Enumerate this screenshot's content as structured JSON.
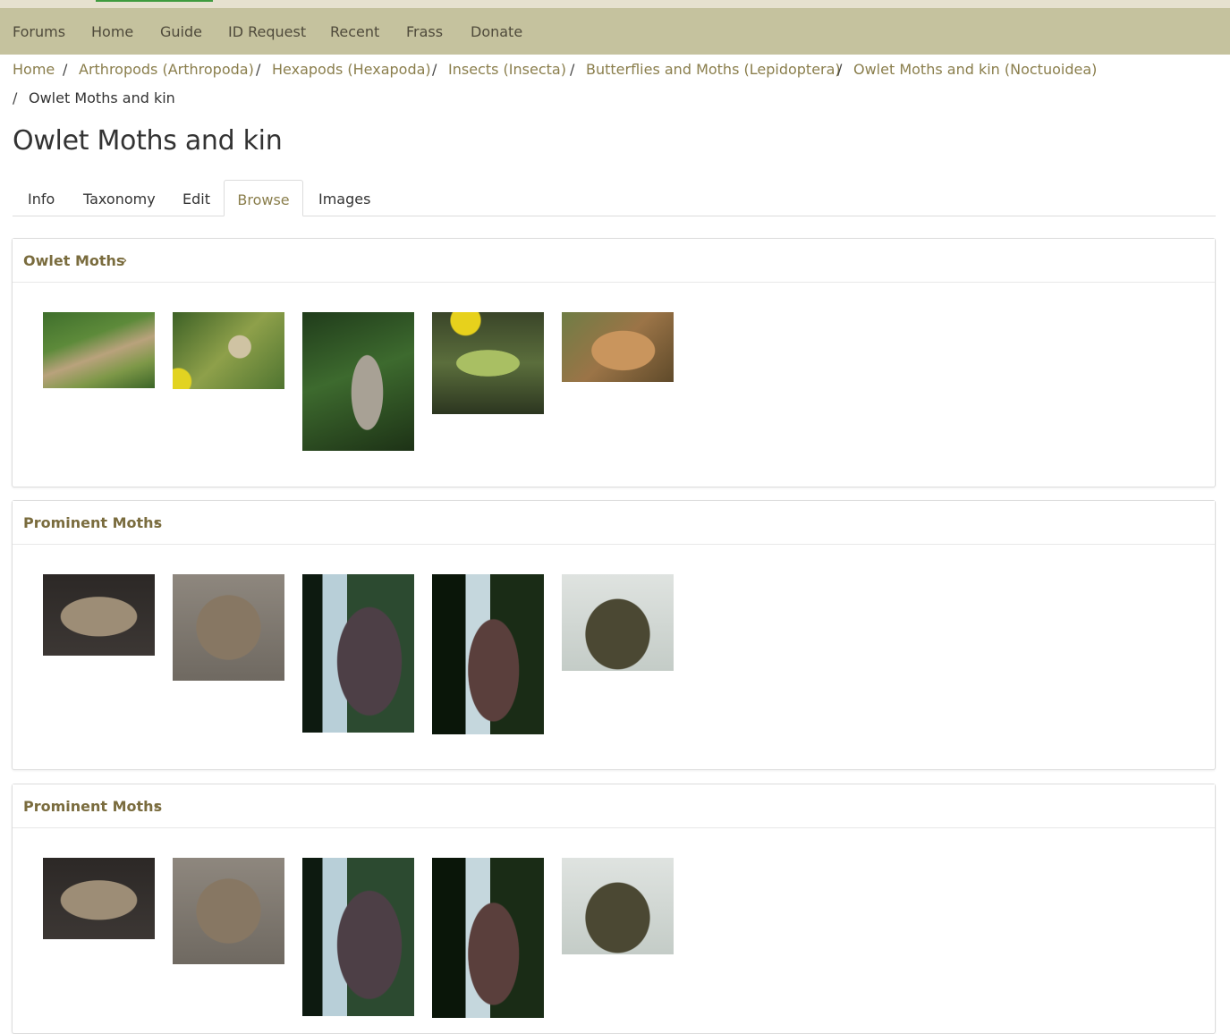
{
  "nav": {
    "items": [
      "Forums",
      "Home",
      "Guide",
      "ID Request",
      "Recent",
      "Frass",
      "Donate"
    ]
  },
  "breadcrumb": {
    "items": [
      "Home",
      "Arthropods (Arthropoda)",
      "Hexapods (Hexapoda)",
      "Insects (Insecta)",
      "Butterflies and Moths (Lepidoptera)",
      "Owlet Moths and kin (Noctuoidea)"
    ],
    "current": "Owlet Moths and kin",
    "separator": "/"
  },
  "page": {
    "title": "Owlet Moths and kin"
  },
  "tabs": {
    "items": [
      "Info",
      "Taxonomy",
      "Edit",
      "Browse",
      "Images"
    ],
    "active": "Browse"
  },
  "groups": [
    {
      "title": "Owlet Moths",
      "chevron": "›"
    },
    {
      "title": "Prominent Moths",
      "chevron": "›"
    },
    {
      "title": "Prominent Moths",
      "chevron": "›"
    }
  ],
  "icons": {
    "chevron": "chevron-right-icon"
  },
  "colors": {
    "navbar": "#c5c29e",
    "link": "#8a7e4c",
    "group_title": "#7a6c3e",
    "top_accent": "#3f9b3f"
  }
}
